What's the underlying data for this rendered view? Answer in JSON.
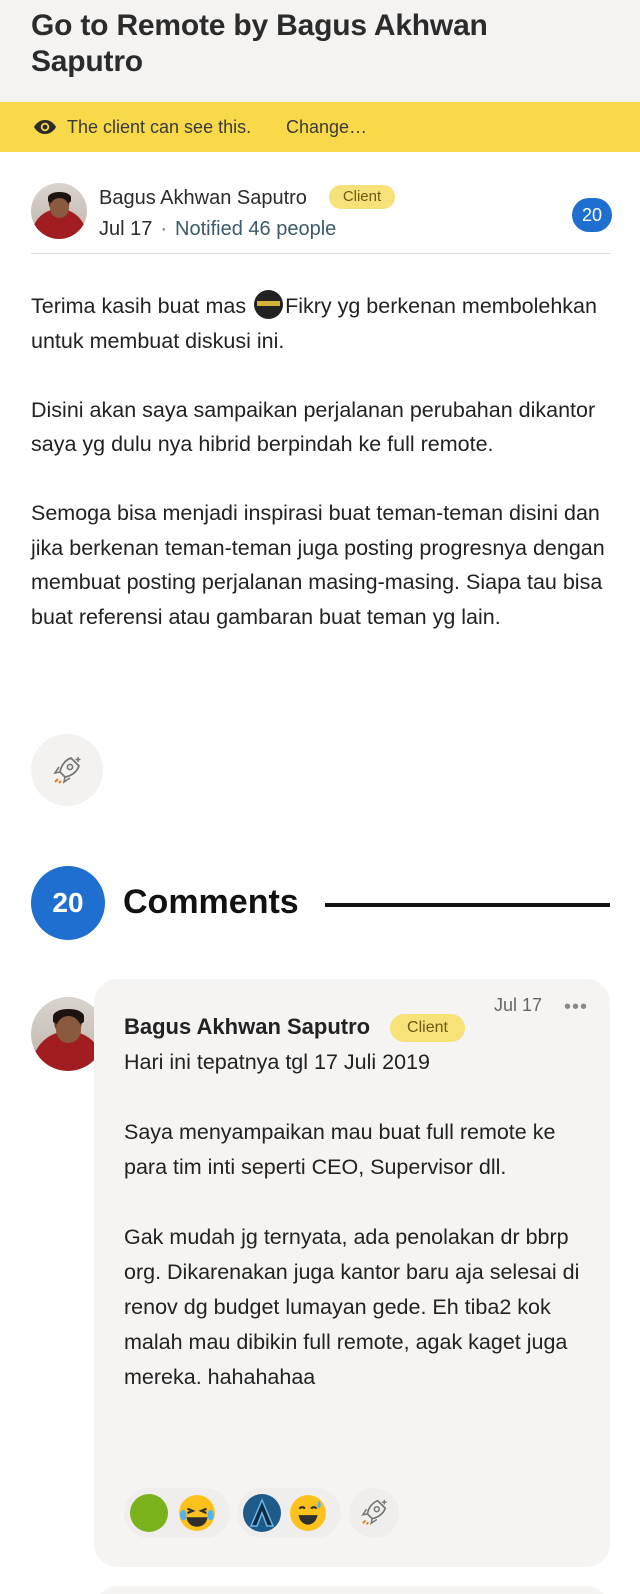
{
  "header": {
    "title": "Go to Remote by Bagus Akhwan Saputro"
  },
  "visibility": {
    "text": "The client can see this.",
    "change_label": "Change…",
    "icon": "eye-icon"
  },
  "post": {
    "author": "Bagus Akhwan Saputro",
    "author_badge": "Client",
    "date": "Jul 17",
    "separator": "·",
    "notified": "Notified 46 people",
    "count": "20",
    "body": [
      {
        "before": "Terima kasih buat mas ",
        "after": "Fikry yg berkenan membolehkan untuk membuat diskusi ini."
      },
      "Disini akan saya sampaikan perjalanan perubahan dikantor saya yg dulu nya hibrid berpindah ke full remote.",
      "Semoga bisa menjadi inspirasi buat teman-teman disini dan jika berkenan teman-teman juga posting progresnya dengan membuat posting perjalanan masing-masing. Siapa tau bisa buat referensi atau gambaran buat teman yg lain."
    ],
    "boost_icon": "rocket-boost-icon"
  },
  "comments": {
    "count": "20",
    "title": "Comments",
    "items": [
      {
        "author": "Bagus Akhwan Saputro",
        "author_badge": "Client",
        "date": "Jul 17",
        "more_label": "•••",
        "body": [
          "Hari ini tepatnya tgl 17 Juli 2019",
          "Saya menyampaikan mau buat full remote ke para tim inti seperti CEO, Supervisor dll.",
          "Gak mudah jg ternyata, ada penolakan dr bbrp org. Dikarenakan juga kantor baru aja selesai di renov dg budget lumayan gede. Eh tiba2 kok malah mau dibikin full remote, agak kaget juga mereka. hahahahaa"
        ],
        "reactions": [
          "laughing-tears-emoji",
          "sweat-smile-emoji",
          "rocket-boost-icon"
        ]
      }
    ]
  },
  "colors": {
    "accent_blue": "#1e6fd0",
    "banner_yellow": "#f8d94a",
    "badge_yellow": "#f7e27a"
  }
}
